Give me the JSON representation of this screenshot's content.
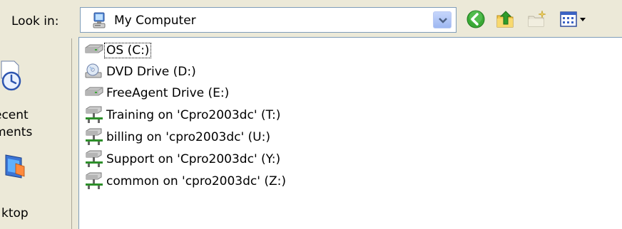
{
  "toolbar": {
    "look_in_label": "Look in:",
    "location": "My Computer",
    "location_icon": "my-computer-icon",
    "buttons": [
      {
        "name": "back-button",
        "icon": "back-arrow-icon"
      },
      {
        "name": "up-one-level-button",
        "icon": "up-folder-icon"
      },
      {
        "name": "new-folder-button",
        "icon": "new-folder-icon"
      },
      {
        "name": "views-menu-button",
        "icon": "views-icon"
      }
    ]
  },
  "places": {
    "recent_label": "ecent\nments",
    "desktop_label": "ktop"
  },
  "files": [
    {
      "label": "OS (C:)",
      "icon": "hard-drive-icon",
      "focused": true
    },
    {
      "label": "DVD Drive (D:)",
      "icon": "dvd-drive-icon",
      "focused": false
    },
    {
      "label": "FreeAgent Drive (E:)",
      "icon": "hard-drive-icon",
      "focused": false
    },
    {
      "label": "Training on 'Cpro2003dc' (T:)",
      "icon": "network-drive-icon",
      "focused": false
    },
    {
      "label": "billing on 'cpro2003dc' (U:)",
      "icon": "network-drive-icon",
      "focused": false
    },
    {
      "label": "Support on 'Cpro2003dc' (Y:)",
      "icon": "network-drive-icon",
      "focused": false
    },
    {
      "label": "common on 'cpro2003dc' (Z:)",
      "icon": "network-drive-icon",
      "focused": false
    }
  ],
  "colors": {
    "dialog_bg": "#ece9d8",
    "list_bg": "#ffffff",
    "border": "#7f9db9",
    "back_green": "#3aa935"
  }
}
